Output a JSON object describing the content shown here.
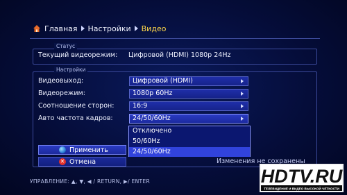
{
  "breadcrumb": {
    "items": [
      "Главная",
      "Настройки",
      "Видео"
    ]
  },
  "status": {
    "title": "Статус",
    "label": "Текущий видеорежим:",
    "value": "Цифровой (HDMI) 1080p 24Hz"
  },
  "settings": {
    "title": "Настройки",
    "rows": [
      {
        "label": "Видеовыход:",
        "value": "Цифровой (HDMI)"
      },
      {
        "label": "Видеорежим:",
        "value": "1080p 60Hz"
      },
      {
        "label": "Соотношение сторон:",
        "value": "16:9"
      },
      {
        "label": "Авто частота кадров:",
        "value": "24/50/60Hz"
      }
    ]
  },
  "dropdown": {
    "options": [
      "Отключено",
      "50/60Hz",
      "24/50/60Hz"
    ],
    "selected": "24/50/60Hz"
  },
  "buttons": {
    "apply": "Применить",
    "cancel": "Отмена"
  },
  "changes_text": "Изменения не сохранены",
  "footer": "УПРАВЛЕНИЕ: ▲, ▼, ◀ / RETURN, ▶/ ENTER",
  "logo": {
    "brand": "HDTV.RU",
    "tagline": "ТЕЛЕВИДЕНИЕ И ВИДЕО ВЫСОКОЙ ЧЕТКОСТИ"
  },
  "colors": {
    "background": "#050d3a",
    "field": "#1f2ea9",
    "selected": "#3143dc",
    "accent_crumb": "#ffd84a",
    "cancel_icon": "#e3312a"
  }
}
